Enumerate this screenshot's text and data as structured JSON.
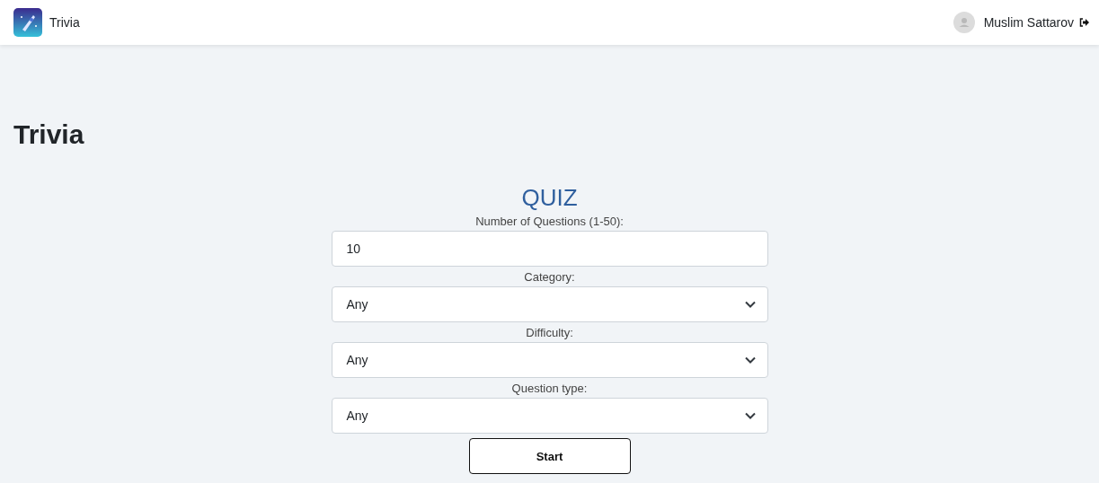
{
  "header": {
    "app_name": "Trivia",
    "user_name": "Muslim Sattarov"
  },
  "page_title": "Trivia",
  "form": {
    "title": "QUIZ",
    "fields": [
      {
        "kind": "text",
        "label": "Number of Questions (1-50):",
        "value": "10"
      },
      {
        "kind": "select",
        "label": "Category:",
        "value": "Any"
      },
      {
        "kind": "select",
        "label": "Difficulty:",
        "value": "Any"
      },
      {
        "kind": "select",
        "label": "Question type:",
        "value": "Any"
      }
    ],
    "button": "Start"
  }
}
